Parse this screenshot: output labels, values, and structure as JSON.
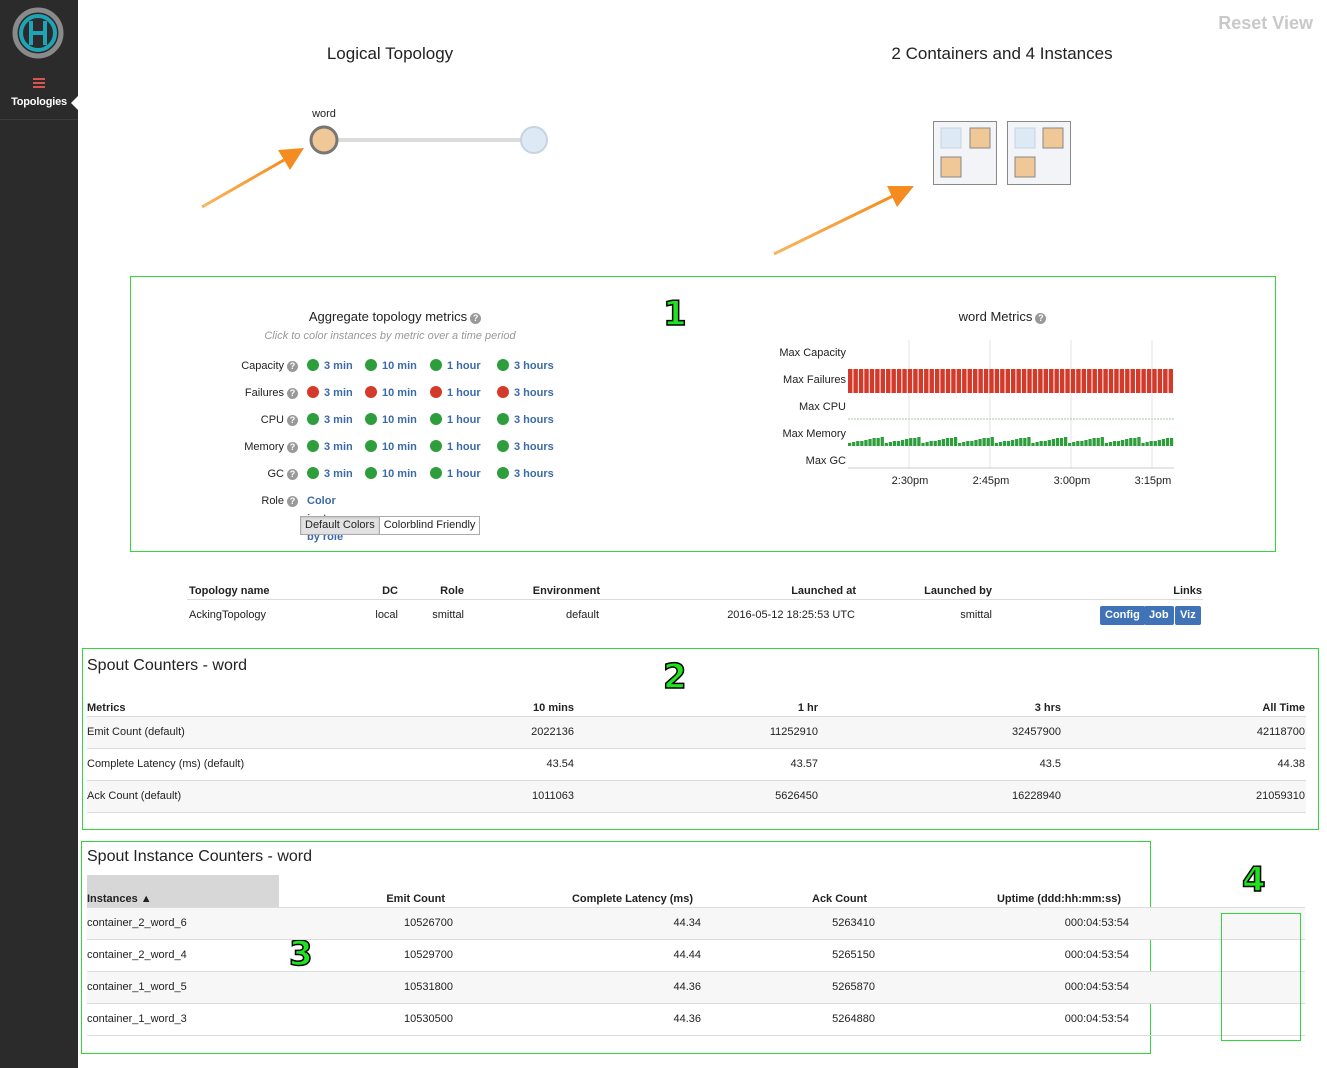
{
  "sidebar": {
    "nav_label": "Topologies"
  },
  "header": {
    "reset_view": "Reset View"
  },
  "logical_topology": {
    "title": "Logical Topology",
    "node_label": "word"
  },
  "physical": {
    "title": "2 Containers and 4 Instances"
  },
  "annotations": [
    "1",
    "2",
    "3",
    "4"
  ],
  "aggregate": {
    "title": "Aggregate topology metrics",
    "subtitle": "Click to color instances by metric over a time period",
    "rows": [
      {
        "label": "Capacity",
        "color": "#2e9e3c",
        "periods": [
          "3 min",
          "10 min",
          "1 hour",
          "3 hours"
        ]
      },
      {
        "label": "Failures",
        "color": "#d43a2a",
        "periods": [
          "3 min",
          "10 min",
          "1 hour",
          "3 hours"
        ]
      },
      {
        "label": "CPU",
        "color": "#2e9e3c",
        "periods": [
          "3 min",
          "10 min",
          "1 hour",
          "3 hours"
        ]
      },
      {
        "label": "Memory",
        "color": "#2e9e3c",
        "periods": [
          "3 min",
          "10 min",
          "1 hour",
          "3 hours"
        ]
      },
      {
        "label": "GC",
        "color": "#2e9e3c",
        "periods": [
          "3 min",
          "10 min",
          "1 hour",
          "3 hours"
        ]
      }
    ],
    "role_label": "Role",
    "role_link": "Color instances by role",
    "color_buttons": [
      "Default Colors",
      "Colorblind Friendly"
    ]
  },
  "word_metrics": {
    "title": "word Metrics",
    "series": [
      "Max Capacity",
      "Max Failures",
      "Max CPU",
      "Max Memory",
      "Max GC"
    ],
    "ticks": [
      "2:30pm",
      "2:45pm",
      "3:00pm",
      "3:15pm"
    ],
    "failure_color": "#d43a2a",
    "memory_color": "#2e9e3c"
  },
  "topology_info": {
    "headers": [
      "Topology name",
      "DC",
      "Role",
      "Environment",
      "Launched at",
      "Launched by",
      "Links"
    ],
    "row": [
      "AckingTopology",
      "local",
      "smittal",
      "default",
      "2016-05-12 18:25:53 UTC",
      "smittal"
    ],
    "links": [
      "Config",
      "Job",
      "Viz"
    ]
  },
  "spout_counters": {
    "title": "Spout Counters - word",
    "headers": [
      "Metrics",
      "10 mins",
      "1 hr",
      "3 hrs",
      "All Time"
    ],
    "rows": [
      [
        "Emit Count (default)",
        "2022136",
        "11252910",
        "32457900",
        "42118700"
      ],
      [
        "Complete Latency (ms) (default)",
        "43.54",
        "43.57",
        "43.5",
        "44.38"
      ],
      [
        "Ack Count (default)",
        "1011063",
        "5626450",
        "16228940",
        "21059310"
      ]
    ]
  },
  "instance_counters": {
    "title": "Spout Instance Counters - word",
    "headers": [
      "Instances ▲",
      "Emit Count",
      "Complete Latency (ms)",
      "Ack Count",
      "Uptime (ddd:hh:mm:ss)"
    ],
    "rows": [
      [
        "container_2_word_6",
        "10526700",
        "44.34",
        "5263410",
        "000:04:53:54"
      ],
      [
        "container_2_word_4",
        "10529700",
        "44.44",
        "5265150",
        "000:04:53:54"
      ],
      [
        "container_1_word_5",
        "10531800",
        "44.36",
        "5265870",
        "000:04:53:54"
      ],
      [
        "container_1_word_3",
        "10530500",
        "44.36",
        "5264880",
        "000:04:53:54"
      ]
    ]
  }
}
